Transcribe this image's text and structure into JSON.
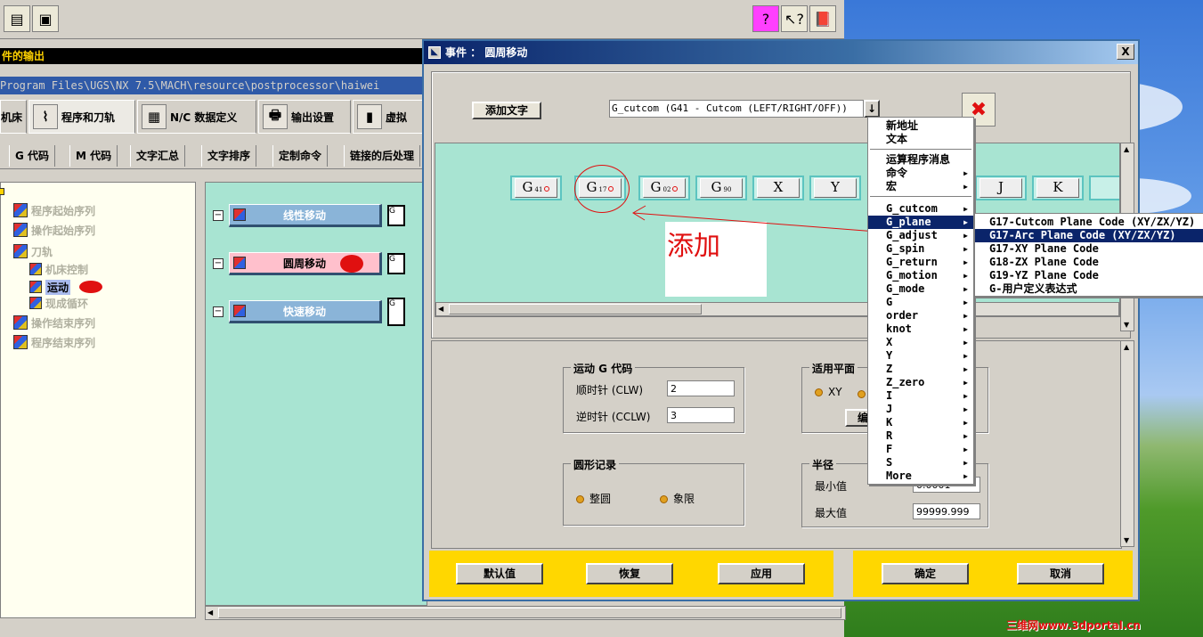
{
  "toolbar": {
    "buttons": [
      "open-icon",
      "save-icon"
    ],
    "help_buttons": [
      "help-balloon-icon",
      "context-help-icon",
      "manual-icon"
    ]
  },
  "output_bar": "件的输出",
  "path": "Program Files\\UGS\\NX 7.5\\MACH\\resource\\postprocessor\\haiwei",
  "main_tabs": [
    {
      "label": "机床",
      "icon": "machine-icon"
    },
    {
      "label": "程序和刀轨",
      "icon": "program-path-icon"
    },
    {
      "label": "N/C 数据定义",
      "icon": "nc-data-icon"
    },
    {
      "label": "输出设置",
      "icon": "printer-icon"
    },
    {
      "label": "虚拟",
      "icon": "virtual-icon"
    }
  ],
  "sub_tabs": [
    "G 代码",
    "M 代码",
    "文字汇总",
    "文字排序",
    "定制命令",
    "链接的后处理"
  ],
  "tree": [
    {
      "label": "程序起始序列"
    },
    {
      "label": "操作起始序列"
    },
    {
      "label": "刀轨"
    },
    {
      "label": "机床控制"
    },
    {
      "label": "运动"
    },
    {
      "label": "现成循环"
    },
    {
      "label": "操作结束序列"
    },
    {
      "label": "程序结束序列"
    }
  ],
  "events": [
    "线性移动",
    "圆周移动",
    "快速移动"
  ],
  "dialog": {
    "title": "事件 ： 圆周移动",
    "close": "X",
    "add_text": "添加文字",
    "combo_value": "G_cutcom (G41 - Cutcom (LEFT/RIGHT/OFF))",
    "combo_arrow": "↓",
    "blocks": [
      {
        "main": "G",
        "sub": "41"
      },
      {
        "main": "G",
        "sub": "17"
      },
      {
        "main": "G",
        "sub": "02"
      },
      {
        "main": "G",
        "sub": "90"
      },
      {
        "main": "X",
        "sub": ""
      },
      {
        "main": "Y",
        "sub": ""
      },
      {
        "main": "J",
        "sub": ""
      },
      {
        "main": "K",
        "sub": ""
      }
    ],
    "annotation": "添加",
    "motion_group": {
      "title": "运动 G 代码",
      "cw_label": "顺时针 (CLW)",
      "cw_value": "2",
      "ccw_label": "逆时针 (CCLW)",
      "ccw_value": "3"
    },
    "plane_group": {
      "title": "适用平面",
      "xy": "XY",
      "edit_btn": "编"
    },
    "circle_group": {
      "title": "圆形记录",
      "full": "整圆",
      "quadrant": "象限"
    },
    "radius_group": {
      "title": "半径",
      "min_label": "最小值",
      "min_value": "0.0001",
      "max_label": "最大值",
      "max_value": "99999.999"
    },
    "buttons": {
      "default": "默认值",
      "restore": "恢复",
      "apply": "应用",
      "ok": "确定",
      "cancel": "取消"
    }
  },
  "context_menu": [
    {
      "label": "新地址",
      "sub": false
    },
    {
      "label": "文本",
      "sub": false
    },
    {
      "label": "运算程序消息",
      "sub": false
    },
    {
      "label": "命令",
      "sub": true
    },
    {
      "label": "宏",
      "sub": true
    },
    {
      "label": "G_cutcom",
      "sub": true
    },
    {
      "label": "G_plane",
      "sub": true
    },
    {
      "label": "G_adjust",
      "sub": true
    },
    {
      "label": "G_spin",
      "sub": true
    },
    {
      "label": "G_return",
      "sub": true
    },
    {
      "label": "G_motion",
      "sub": true
    },
    {
      "label": "G_mode",
      "sub": true
    },
    {
      "label": "G",
      "sub": true
    },
    {
      "label": "order",
      "sub": true
    },
    {
      "label": "knot",
      "sub": true
    },
    {
      "label": "X",
      "sub": true
    },
    {
      "label": "Y",
      "sub": true
    },
    {
      "label": "Z",
      "sub": true
    },
    {
      "label": "Z_zero",
      "sub": true
    },
    {
      "label": "I",
      "sub": true
    },
    {
      "label": "J",
      "sub": true
    },
    {
      "label": "K",
      "sub": true
    },
    {
      "label": "R",
      "sub": true
    },
    {
      "label": "F",
      "sub": true
    },
    {
      "label": "S",
      "sub": true
    },
    {
      "label": "More",
      "sub": true
    }
  ],
  "submenu": [
    "G17-Cutcom Plane Code (XY/ZX/YZ)",
    "G17-Arc Plane Code (XY/ZX/YZ)",
    "G17-XY Plane Code",
    "G18-ZX Plane Code",
    "G19-YZ Plane Code",
    "G-用户定义表达式"
  ],
  "watermark": "三维网www.3dportal.cn",
  "colors": {
    "title_bar": "#0a246a",
    "menu_highlight": "#0a246a",
    "canvas": "#a8e4d2",
    "button_bar": "#ffd700",
    "annotation": "#e01010"
  }
}
